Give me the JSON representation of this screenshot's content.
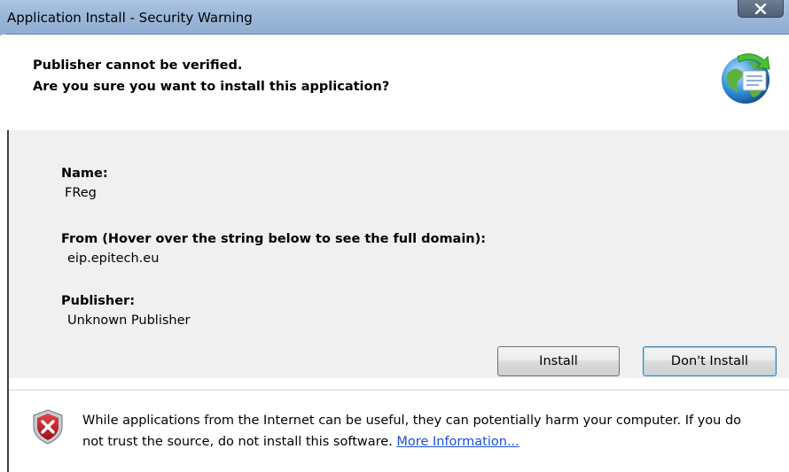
{
  "window": {
    "title": "Application Install - Security Warning",
    "close_label": "X"
  },
  "header": {
    "line1": "Publisher cannot be verified.",
    "line2": "Are you sure you want to install this application?"
  },
  "details": {
    "name_label": "Name:",
    "name_value": "FReg",
    "from_label": "From (Hover over the string below to see the full domain):",
    "from_value": "eip.epitech.eu",
    "publisher_label": "Publisher:",
    "publisher_value": "Unknown Publisher"
  },
  "buttons": {
    "install": "Install",
    "dont_install": "Don't Install"
  },
  "warning": {
    "text": "While applications from the Internet can be useful, they can potentially harm your computer. If you do not trust the source, do not install this software.",
    "link": "More Information..."
  },
  "icons": {
    "header": "globe-install-icon",
    "warning": "shield-warning-icon",
    "close": "close-icon"
  }
}
